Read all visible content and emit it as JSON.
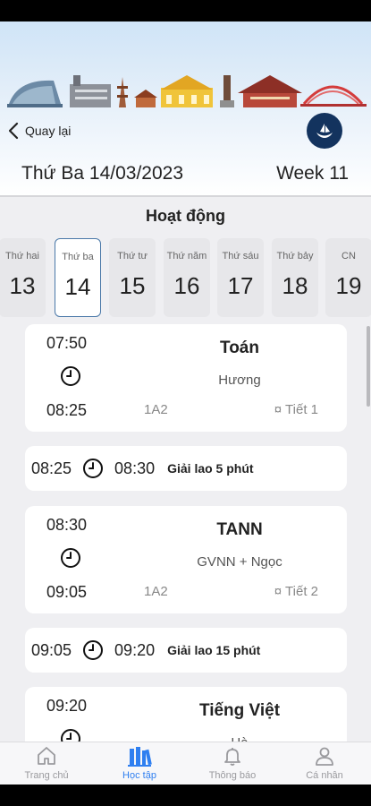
{
  "nav": {
    "back_label": "Quay lại"
  },
  "header": {
    "date_title": "Thứ Ba 14/03/2023",
    "week_label": "Week 11"
  },
  "section": {
    "title": "Hoạt động"
  },
  "days": [
    {
      "name": "Thứ hai",
      "date": "13"
    },
    {
      "name": "Thứ ba",
      "date": "14"
    },
    {
      "name": "Thứ tư",
      "date": "15"
    },
    {
      "name": "Thứ năm",
      "date": "16"
    },
    {
      "name": "Thứ sáu",
      "date": "17"
    },
    {
      "name": "Thứ bảy",
      "date": "18"
    },
    {
      "name": "CN",
      "date": "19"
    }
  ],
  "schedule": {
    "lesson1": {
      "start": "07:50",
      "end": "08:25",
      "subject": "Toán",
      "teacher": "Hương",
      "room": "1A2",
      "period": "¤ Tiết 1"
    },
    "break1": {
      "start": "08:25",
      "end": "08:30",
      "label": "Giải lao 5 phút"
    },
    "lesson2": {
      "start": "08:30",
      "end": "09:05",
      "subject": "TANN",
      "teacher": "GVNN + Ngọc",
      "room": "1A2",
      "period": "¤ Tiết 2"
    },
    "break2": {
      "start": "09:05",
      "end": "09:20",
      "label": "Giải lao 15 phút"
    },
    "lesson3": {
      "start": "09:20",
      "subject": "Tiếng Việt",
      "teacher": "Hà"
    }
  },
  "tabs": [
    {
      "label": "Trang chủ",
      "icon": "home-icon"
    },
    {
      "label": "Học tập",
      "icon": "books-icon"
    },
    {
      "label": "Thông báo",
      "icon": "bell-icon"
    },
    {
      "label": "Cá nhân",
      "icon": "user-icon"
    }
  ],
  "colors": {
    "accent": "#2f7ff0",
    "logo_bg": "#13335e",
    "active_day_border": "#4a78a8"
  }
}
